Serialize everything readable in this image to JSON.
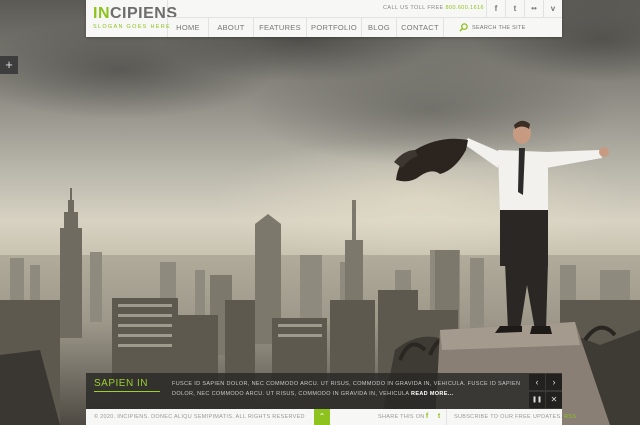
{
  "logo": {
    "prefix": "IN",
    "rest": "CIPIENS",
    "slogan": "SLOGAN GOES HERE"
  },
  "topbar": {
    "call_label": "CALL US TOLL FREE",
    "phone": "800.600.1616"
  },
  "social": [
    {
      "icon": "facebook-icon",
      "glyph": "f"
    },
    {
      "icon": "twitter-icon",
      "glyph": "t"
    },
    {
      "icon": "flickr-icon",
      "glyph": "••"
    },
    {
      "icon": "vimeo-icon",
      "glyph": "v"
    }
  ],
  "nav": [
    {
      "label": "HOME"
    },
    {
      "label": "ABOUT"
    },
    {
      "label": "FEATURES"
    },
    {
      "label": "PORTFOLIO"
    },
    {
      "label": "BLOG"
    },
    {
      "label": "CONTACT"
    }
  ],
  "search": {
    "placeholder": "SEARCH THE SITE"
  },
  "side_tab": {
    "glyph": "+"
  },
  "caption": {
    "title": "SAPIEN IN",
    "text": "FUSCE ID SAPIEN DOLOR, NEC COMMODO ARCU. UT RISUS, COMMODO IN GRAVIDA IN, VEHICULA. FUSCE ID SAPIEN DOLOR, NEC COMMODO ARCU. UT RISUS, COMMODO IN GRAVIDA IN, VEHICULA",
    "more": "READ MORE...",
    "prev": "‹",
    "next": "›",
    "pause": "❚❚",
    "close": "✕"
  },
  "footer": {
    "copyright": "© 2020. INCIPIENS. DONEC ALIQU SEMIPIMATIS. ALL RIGHTS RESERVED",
    "up": "⌃",
    "share_label": "SHARE THIS ON",
    "share_icons": [
      {
        "icon": "facebook-icon",
        "glyph": "f"
      },
      {
        "icon": "twitter-icon",
        "glyph": "t"
      }
    ],
    "subscribe_label": "SUBSCRIBE TO OUR FREE UPDATES.",
    "rss": "RSS"
  },
  "colors": {
    "accent": "#8dc21f",
    "header_bg": "#f7f7f5",
    "caption_bg": "#282826"
  }
}
